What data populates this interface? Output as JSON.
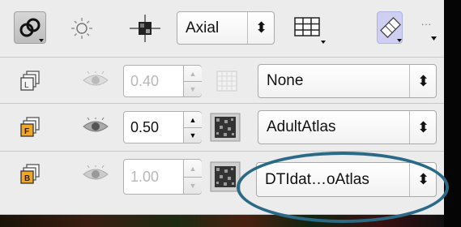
{
  "toolbar": {
    "view_select": "Axial",
    "more_label": "···"
  },
  "layers": [
    {
      "name": "L",
      "opacity": "0.40",
      "blend": "None",
      "enabled": false
    },
    {
      "name": "F",
      "opacity": "0.50",
      "blend": "AdultAtlas",
      "enabled": true
    },
    {
      "name": "B",
      "opacity": "1.00",
      "blend": "DTIdat…oAtlas",
      "enabled": false
    }
  ],
  "icons": {
    "link": "link-icon",
    "crosshair": "crosshair-icon",
    "layout": "grid-layout-icon",
    "tag": "tag-icon",
    "eye": "eye-icon",
    "checker": "checker-icon"
  },
  "colors": {
    "panel_bg": "#ececec",
    "badge_orange": "#f4a623",
    "highlight": "#2b6a86",
    "dropdown_bg": "#cfcff3"
  }
}
